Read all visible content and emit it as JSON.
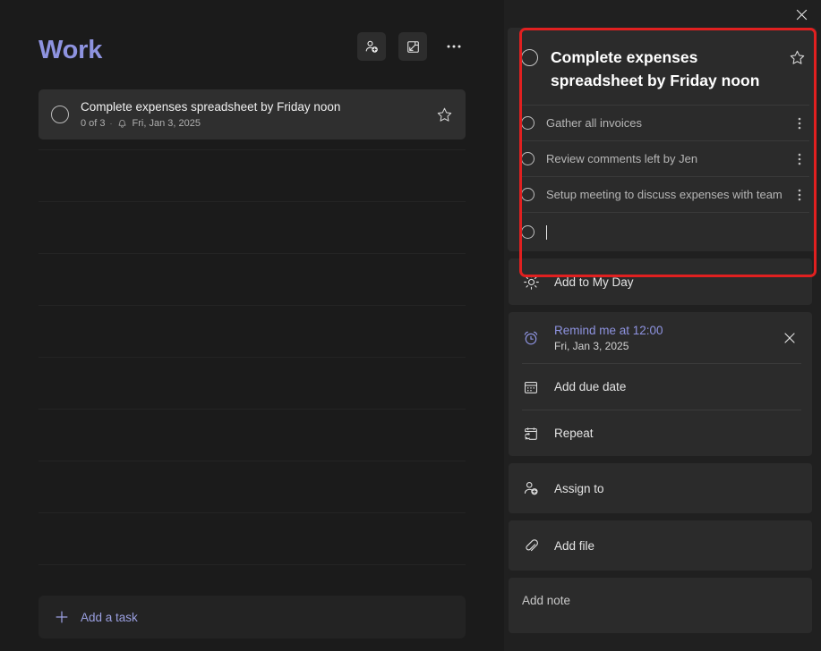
{
  "app": {
    "accent_color": "#8e93e0",
    "highlight_color": "#e02020",
    "list_background": "#1b1b1b",
    "detail_background": "#202020",
    "card_background": "#2b2b2b"
  },
  "list_pane": {
    "title": "Work",
    "actions": [
      {
        "name": "share-list",
        "icon": "person-add-icon",
        "tooltip": "Share list"
      },
      {
        "name": "collapse-pane",
        "icon": "collapse-arrow-box-icon",
        "tooltip": "Collapse"
      },
      {
        "name": "list-options",
        "icon": "ellipsis-icon",
        "label": "•••",
        "tooltip": "List options"
      }
    ],
    "tasks": [
      {
        "title": "Complete expenses spreadsheet by Friday noon",
        "progress": "0 of 3",
        "separator": "·",
        "reminder_icon": "bell-icon",
        "due": "Fri, Jan 3, 2025",
        "starred": false,
        "completed": false
      }
    ],
    "empty_row_count": 9,
    "add_task": {
      "icon": "plus-icon",
      "label": "Add a task"
    }
  },
  "detail_pane": {
    "close_label": "Close detail view",
    "close_icon": "close-icon",
    "task": {
      "title": "Complete expenses spreadsheet by Friday noon",
      "completed": false,
      "starred": false,
      "star_icon": "star-outline-icon",
      "subtasks": [
        {
          "label": "Gather all invoices",
          "completed": false,
          "menu_icon": "vertical-ellipsis-icon"
        },
        {
          "label": "Review comments left by Jen",
          "completed": false,
          "menu_icon": "vertical-ellipsis-icon"
        },
        {
          "label": "Setup meeting to discuss expenses with team",
          "completed": false,
          "menu_icon": "vertical-ellipsis-icon"
        }
      ],
      "new_subtask": {
        "value": "",
        "placeholder": "",
        "focused": true
      }
    },
    "my_day": {
      "icon": "sun-icon",
      "label": "Add to My Day"
    },
    "reminder": {
      "icon": "alarm-clock-icon",
      "label": "Remind me at 12:00",
      "sub_label": "Fri, Jan 3, 2025",
      "clear_icon": "close-icon"
    },
    "due_date": {
      "icon": "calendar-icon",
      "label": "Add due date"
    },
    "repeat": {
      "icon": "repeat-calendar-icon",
      "label": "Repeat"
    },
    "assign": {
      "icon": "person-add-icon",
      "label": "Assign to"
    },
    "add_file": {
      "icon": "paperclip-icon",
      "label": "Add file"
    },
    "note": {
      "placeholder": "Add note",
      "value": ""
    }
  }
}
